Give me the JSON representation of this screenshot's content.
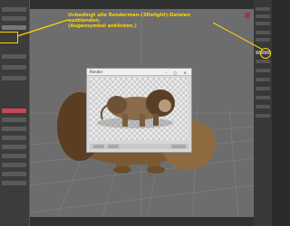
{
  "annotation": {
    "line1": "Unbedingt alle Renderman-(3Delight)-Dateien ausblenden.",
    "line2": "(Augensymbol anklicken.)"
  },
  "render_window": {
    "title": "Render",
    "controls": "– ▢ ✕"
  },
  "colors": {
    "accent": "#ffd400",
    "viewport_bg": "#6d6d6d",
    "panel_bg": "#3c3c3c"
  },
  "icons": {
    "eye_toggle": "eye-icon"
  }
}
